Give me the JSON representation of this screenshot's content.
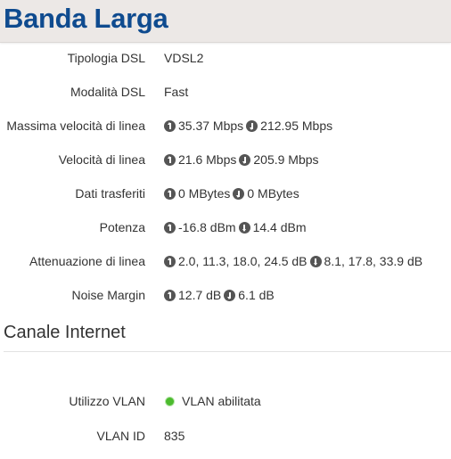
{
  "header": {
    "title": "Banda Larga"
  },
  "dsl": {
    "rows": [
      {
        "label": "Tipologia DSL",
        "value": "VDSL2"
      },
      {
        "label": "Modalità DSL",
        "value": "Fast"
      },
      {
        "label": "Massima velocità di linea",
        "up": "35.37 Mbps",
        "down": "212.95 Mbps"
      },
      {
        "label": "Velocità di linea",
        "up": "21.6 Mbps",
        "down": "205.9 Mbps"
      },
      {
        "label": "Dati trasferiti",
        "up": "0 MBytes",
        "down": "0 MBytes"
      },
      {
        "label": "Potenza",
        "up": "-16.8 dBm",
        "down": "14.4 dBm"
      },
      {
        "label": "Attenuazione di linea",
        "up": "2.0, 11.3, 18.0, 24.5 dB",
        "down": "8.1, 17.8, 33.9 dB"
      },
      {
        "label": "Noise Margin",
        "up": "12.7 dB",
        "down": "6.1 dB"
      }
    ]
  },
  "internet": {
    "title": "Canale Internet",
    "rows": [
      {
        "label": "Utilizzo VLAN",
        "value": "VLAN abilitata",
        "status_color": "#4cbb2e"
      },
      {
        "label": "VLAN ID",
        "value": "835"
      }
    ]
  },
  "icons": {
    "up": "arrow-up-circle-icon",
    "down": "arrow-down-circle-icon",
    "status": "status-dot-icon"
  }
}
